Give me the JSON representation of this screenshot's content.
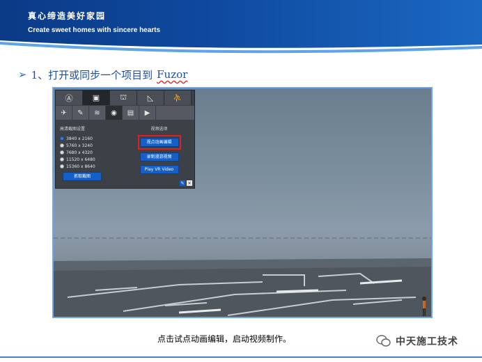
{
  "banner": {
    "title_cn": "真心缔造美好家园",
    "title_en": "Create sweet homes with sincere hearts",
    "colors": {
      "dark": "#0b3a86",
      "light": "#1b68c2"
    }
  },
  "heading": {
    "bullet": "➢",
    "text": "1、打开或同步一个项目到",
    "app_name": "Fuzor"
  },
  "fuzor": {
    "top_tabs": [
      {
        "icon": "steering-icon",
        "glyph": "Ⓐ",
        "active": false
      },
      {
        "icon": "camera-tab-icon",
        "glyph": "▣",
        "active": true
      },
      {
        "icon": "building-icon",
        "glyph": "⛫",
        "active": false
      },
      {
        "icon": "ruler-icon",
        "glyph": "◺",
        "active": false
      },
      {
        "icon": "people-icon",
        "glyph": "⛹",
        "active": false
      }
    ],
    "sub_tabs": [
      {
        "icon": "walk-icon",
        "glyph": "✈",
        "active": false
      },
      {
        "icon": "brush-icon",
        "glyph": "✎",
        "active": false
      },
      {
        "icon": "layers-icon",
        "glyph": "≋",
        "active": false
      },
      {
        "icon": "camera-icon",
        "glyph": "◉",
        "active": true
      },
      {
        "icon": "screenshot-icon",
        "glyph": "▤",
        "active": false
      },
      {
        "icon": "play-icon",
        "glyph": "▶",
        "active": false
      }
    ],
    "resolution": {
      "title": "高清截图设置",
      "options": [
        "3840 x 2160",
        "5760 x 3240",
        "7680 x 4320",
        "11520 x 6480",
        "15360 x 8640"
      ],
      "selected_index": 0,
      "capture_label": "抓取截图"
    },
    "video": {
      "title": "视频选项",
      "edit_label": "视点动画编辑",
      "record_label": "录制漫游视频",
      "vr_label": "Play VR Video"
    }
  },
  "caption": "点击试点动画编辑，启动视频制作。",
  "watermark": "中天施工技术"
}
